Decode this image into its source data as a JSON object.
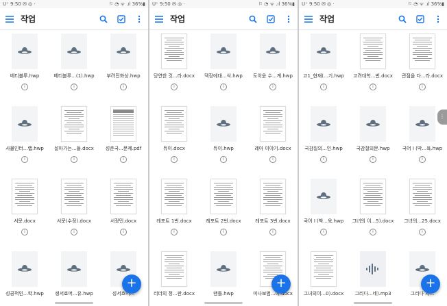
{
  "colors": {
    "accent": "#1a73e8",
    "icon_gray": "#5f6f7f"
  },
  "screens": [
    {
      "status_left": "U⁺ 9:50 ✉ ◎ ·",
      "status_right": "⚐ ◔ ᯤ .ıl 36%▮",
      "title": "작업",
      "fab": "+",
      "files": [
        {
          "name": "베티블루.hwp",
          "thumb": "ufo-icon"
        },
        {
          "name": "베티블루...(1).hwp",
          "thumb": "ufo-icon"
        },
        {
          "name": "부려진화상.hwp",
          "thumb": "ufo-icon"
        },
        {
          "name": "사물인터...랩.hwp",
          "thumb": "ufo-icon"
        },
        {
          "name": "살아가는...들.docx",
          "thumb": "document-preview"
        },
        {
          "name": "성춘국...문제.pdf",
          "thumb": "pdf-preview"
        },
        {
          "name": "서문.docx",
          "thumb": "document-preview"
        },
        {
          "name": "서문(수정).docx",
          "thumb": "document-preview"
        },
        {
          "name": "서정민.docx",
          "thumb": "document-preview"
        },
        {
          "name": "성공적인...학.hwp",
          "thumb": "ufo-icon"
        },
        {
          "name": "생서효머...유.hwp",
          "thumb": "ufo-icon"
        },
        {
          "name": "성서흐머...",
          "thumb": "ufo-icon"
        }
      ]
    },
    {
      "status_left": "U⁺ 9:50 ✉ ◎ ·",
      "status_right": "⚐ ◔ ᯤ .ıl 36%▮",
      "title": "작업",
      "fab": "+",
      "files": [
        {
          "name": "당연한 것...라.docx",
          "thumb": "document-preview"
        },
        {
          "name": "댁장에대...삭.hwp",
          "thumb": "ufo-icon"
        },
        {
          "name": "도이윤 수...계.hwp",
          "thumb": "ufo-icon"
        },
        {
          "name": "듀이.docx",
          "thumb": "document-preview"
        },
        {
          "name": "듀이.hwp",
          "thumb": "ufo-icon"
        },
        {
          "name": "레아 이야기.docx",
          "thumb": "document-preview"
        },
        {
          "name": "레포트 1번.docx",
          "thumb": "document-preview"
        },
        {
          "name": "레포트 2번.docx",
          "thumb": "document-preview"
        },
        {
          "name": "레포트 3번.docx",
          "thumb": "document-preview"
        },
        {
          "name": "리더의 정...판.docx",
          "thumb": "document-preview"
        },
        {
          "name": "맨틀.hwp",
          "thumb": "ufo-icon"
        },
        {
          "name": "미나보범...여.docx",
          "thumb": "document-preview"
        }
      ]
    },
    {
      "status_left": "U⁺ 9:50 ✉ ◎ ·",
      "status_right": "⚐ ◔ ᯤ .ıl 36%▮",
      "title": "작업",
      "fab": "+",
      "edge_handle": "⋮",
      "files": [
        {
          "name": "고1_현재(...기.hwp",
          "thumb": "ufo-icon"
        },
        {
          "name": "고려대학...번.docx",
          "thumb": "document-preview"
        },
        {
          "name": "관점을 다...라.docx",
          "thumb": "document-preview"
        },
        {
          "name": "국감질의...인.hwp",
          "thumb": "ufo-icon"
        },
        {
          "name": "국감질의문.hwp",
          "thumb": "ufo-icon"
        },
        {
          "name": "국어 I (박...육.hwp",
          "thumb": "ufo-icon"
        },
        {
          "name": "국어 I (박...육.hwp",
          "thumb": "ufo-icon"
        },
        {
          "name": "그녀의 이...5).docx",
          "thumb": "document-preview"
        },
        {
          "name": "그녀의...25.docx",
          "thumb": "document-preview"
        },
        {
          "name": "그녀의이...0).docx",
          "thumb": "document-preview"
        },
        {
          "name": "그리다...네).mp3",
          "thumb": "audio-icon"
        },
        {
          "name": "그리다 지...",
          "thumb": "ufo-icon"
        }
      ]
    }
  ]
}
